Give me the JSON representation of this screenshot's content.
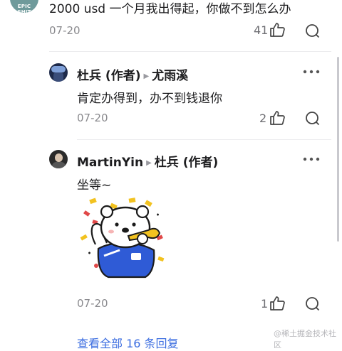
{
  "top_comment": {
    "avatar_text": "EPIC SHIT",
    "text": "2000 usd 一个月我出得起，你做不到怎么办",
    "date": "07-20",
    "likes": "41"
  },
  "replies": [
    {
      "author": "杜兵 (作者)",
      "reply_to": "尤雨溪",
      "text": "肯定办得到，办不到钱退你",
      "date": "07-20",
      "likes": "2"
    },
    {
      "author": "MartinYin",
      "reply_to": "杜兵 (作者)",
      "text": "坐等~",
      "date": "07-20",
      "likes": "1"
    }
  ],
  "footer": {
    "view_all": "查看全部 16 条回复",
    "watermark": "@稀土掘金技术社区"
  },
  "colors": {
    "accent": "#3b6de0",
    "bear_shirt": "#2f5bd6",
    "trumpet": "#f2c21f"
  },
  "icons": [
    "like-icon",
    "comment-icon",
    "more-icon"
  ]
}
